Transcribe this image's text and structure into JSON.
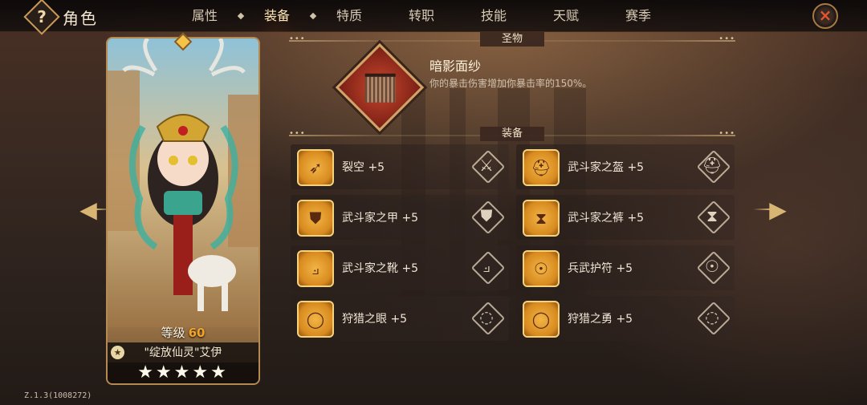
{
  "header": {
    "title": "角色",
    "help_label": "?",
    "close_label": "×",
    "tabs": [
      {
        "label": "属性"
      },
      {
        "label": "装备",
        "active": true
      },
      {
        "label": "特质"
      },
      {
        "label": "转职"
      },
      {
        "label": "技能"
      },
      {
        "label": "天赋"
      },
      {
        "label": "赛季"
      }
    ]
  },
  "hero": {
    "level_label": "等级",
    "level_value": "60",
    "name": "\"绽放仙灵\"艾伊",
    "stars": "★★★★★",
    "star_count": 5,
    "name_icon": "star-badge-icon"
  },
  "relic_section": {
    "title": "圣物",
    "name": "暗影面纱",
    "description": "你的暴击伤害增加你暴击率的150%。",
    "icon": "veil-icon"
  },
  "equip_section": {
    "title": "装备",
    "items": [
      {
        "label": "裂空 +5",
        "icon": "bow-icon",
        "type_icon": "weapon-slot-icon",
        "glyph": "➶",
        "type_glyph": "⚔"
      },
      {
        "label": "武斗家之盔 +5",
        "icon": "helmet-icon",
        "type_icon": "helmet-slot-icon",
        "glyph": "⛑",
        "type_glyph": "⛑"
      },
      {
        "label": "武斗家之甲 +5",
        "icon": "armor-icon",
        "type_icon": "armor-slot-icon",
        "glyph": "⛊",
        "type_glyph": "⛊"
      },
      {
        "label": "武斗家之裤 +5",
        "icon": "pants-icon",
        "type_icon": "pants-slot-icon",
        "glyph": "⧗",
        "type_glyph": "⧗"
      },
      {
        "label": "武斗家之靴 +5",
        "icon": "boots-icon",
        "type_icon": "boots-slot-icon",
        "glyph": "⟓",
        "type_glyph": "⟓"
      },
      {
        "label": "兵武护符 +5",
        "icon": "amulet-icon",
        "type_icon": "amulet-slot-icon",
        "glyph": "☉",
        "type_glyph": "☉"
      },
      {
        "label": "狩猎之眼 +5",
        "icon": "ring-icon",
        "type_icon": "ring-slot-icon",
        "glyph": "◯",
        "type_glyph": "◌"
      },
      {
        "label": "狩猎之勇 +5",
        "icon": "ring-icon",
        "type_icon": "ring-slot-icon",
        "glyph": "◯",
        "type_glyph": "◌"
      }
    ]
  },
  "nav": {
    "prev_glyph": "◀",
    "next_glyph": "▶"
  },
  "version": "Z.1.3(1008272)",
  "colors": {
    "accent": "#f2b545",
    "active_tab_glow": "#d2461e",
    "level": "#f3a428"
  }
}
